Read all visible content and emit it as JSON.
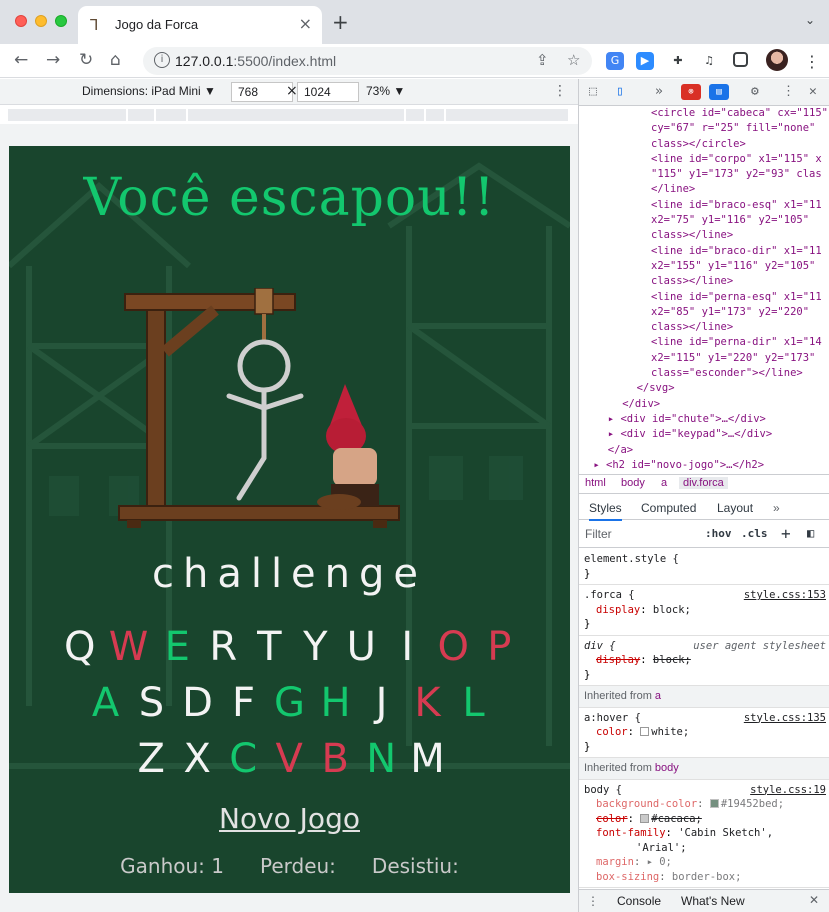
{
  "browser": {
    "tab_title": "Jogo da Forca",
    "url_host": "127.0.0.1",
    "url_rest": ":5500/index.html"
  },
  "device_toolbar": {
    "dimensions_label": "Dimensions: iPad Mini ▼",
    "width": "768",
    "height": "1024",
    "zoom": "73% ▼"
  },
  "game": {
    "title": "Você escapou!!",
    "secret_word": "challenge",
    "keypad_rows": [
      [
        {
          "letter": "Q",
          "state": "unused"
        },
        {
          "letter": "W",
          "state": "wrong"
        },
        {
          "letter": "E",
          "state": "correct"
        },
        {
          "letter": "R",
          "state": "unused"
        },
        {
          "letter": "T",
          "state": "unused"
        },
        {
          "letter": "Y",
          "state": "unused"
        },
        {
          "letter": "U",
          "state": "unused"
        },
        {
          "letter": "I",
          "state": "unused"
        },
        {
          "letter": "O",
          "state": "wrong"
        },
        {
          "letter": "P",
          "state": "wrong"
        }
      ],
      [
        {
          "letter": "A",
          "state": "correct"
        },
        {
          "letter": "S",
          "state": "unused"
        },
        {
          "letter": "D",
          "state": "unused"
        },
        {
          "letter": "F",
          "state": "unused"
        },
        {
          "letter": "G",
          "state": "correct"
        },
        {
          "letter": "H",
          "state": "correct"
        },
        {
          "letter": "J",
          "state": "unused"
        },
        {
          "letter": "K",
          "state": "wrong"
        },
        {
          "letter": "L",
          "state": "correct"
        }
      ],
      [
        {
          "letter": "Z",
          "state": "unused"
        },
        {
          "letter": "X",
          "state": "unused"
        },
        {
          "letter": "C",
          "state": "correct"
        },
        {
          "letter": "V",
          "state": "wrong"
        },
        {
          "letter": "B",
          "state": "wrong"
        },
        {
          "letter": "N",
          "state": "correct"
        },
        {
          "letter": "M",
          "state": "unused"
        }
      ]
    ],
    "new_game_label": "Novo Jogo",
    "stats": {
      "won_label": "Ganhou: 1",
      "lost_label": "Perdeu:",
      "gave_up_label": "Desistiu:"
    },
    "colors": {
      "correct": "#13c76e",
      "wrong": "#d63b51",
      "background": "#19452d"
    }
  },
  "devtools": {
    "dom_lines": [
      {
        "indent": 10,
        "html": "<circle id=\"cabeca\" cx=\"115\""
      },
      {
        "indent": 10,
        "html": "cy=\"67\" r=\"25\" fill=\"none\""
      },
      {
        "indent": 10,
        "html": "class></circle>"
      },
      {
        "indent": 10,
        "html": "<line id=\"corpo\" x1=\"115\" x"
      },
      {
        "indent": 10,
        "html": "\"115\" y1=\"173\" y2=\"93\" clas"
      },
      {
        "indent": 10,
        "html": "</line>"
      },
      {
        "indent": 10,
        "html": "<line id=\"braco-esq\" x1=\"11"
      },
      {
        "indent": 10,
        "html": "x2=\"75\" y1=\"116\" y2=\"105\""
      },
      {
        "indent": 10,
        "html": "class></line>"
      },
      {
        "indent": 10,
        "html": "<line id=\"braco-dir\" x1=\"11"
      },
      {
        "indent": 10,
        "html": "x2=\"155\" y1=\"116\" y2=\"105\""
      },
      {
        "indent": 10,
        "html": "class></line>"
      },
      {
        "indent": 10,
        "html": "<line id=\"perna-esq\" x1=\"11"
      },
      {
        "indent": 10,
        "html": "x2=\"85\" y1=\"173\" y2=\"220\""
      },
      {
        "indent": 10,
        "html": "class></line>"
      },
      {
        "indent": 10,
        "html": "<line id=\"perna-dir\" x1=\"14"
      },
      {
        "indent": 10,
        "html": "x2=\"115\" y1=\"220\" y2=\"173\""
      },
      {
        "indent": 10,
        "html": "class=\"esconder\"></line>"
      },
      {
        "indent": 8,
        "html": "</svg>"
      },
      {
        "indent": 6,
        "html": "</div>"
      },
      {
        "indent": 4,
        "html": "▸ <div id=\"chute\">…</div>"
      },
      {
        "indent": 4,
        "html": "▸ <div id=\"keypad\">…</div>"
      },
      {
        "indent": 4,
        "html": "</a>"
      },
      {
        "indent": 2,
        "html": "▸ <h2 id=\"novo-jogo\">…</h2>"
      }
    ],
    "breadcrumbs": [
      "html",
      "body",
      "a",
      "div.forca"
    ],
    "pane_tabs": [
      "Styles",
      "Computed",
      "Layout",
      "»"
    ],
    "filter_placeholder": "Filter",
    "filter_hov": ":hov",
    "filter_cls": ".cls",
    "rules": {
      "element_style": "element.style {",
      "forca_selector": ".forca {",
      "forca_src": "style.css:153",
      "forca_prop": "display",
      "forca_val": "block;",
      "div_selector": "div {",
      "div_src": "user agent stylesheet",
      "div_prop": "display",
      "div_val": "block;",
      "inherited_a_prefix": "Inherited from ",
      "inherited_a": "a",
      "ahover_selector": "a:hover {",
      "ahover_src": "style.css:135",
      "ahover_prop": "color",
      "ahover_val": "white;",
      "inherited_body_prefix": "Inherited from ",
      "inherited_body": "body",
      "body_selector": "body {",
      "body_src": "style.css:19",
      "body_bg_prop": "background-color",
      "body_bg_val": "#19452bed;",
      "body_color_prop": "color",
      "body_color_val": "#cacaca;",
      "body_font_prop": "font-family",
      "body_font_val": "'Cabin Sketch',",
      "body_font_val2": "'Arial';",
      "body_margin_prop": "margin",
      "body_margin_val": "▸ 0;",
      "body_box_prop": "box-sizing",
      "body_box_val": "border-box;",
      "close_brace": "}"
    },
    "console_tab": "Console",
    "whats_new_tab": "What's New"
  }
}
